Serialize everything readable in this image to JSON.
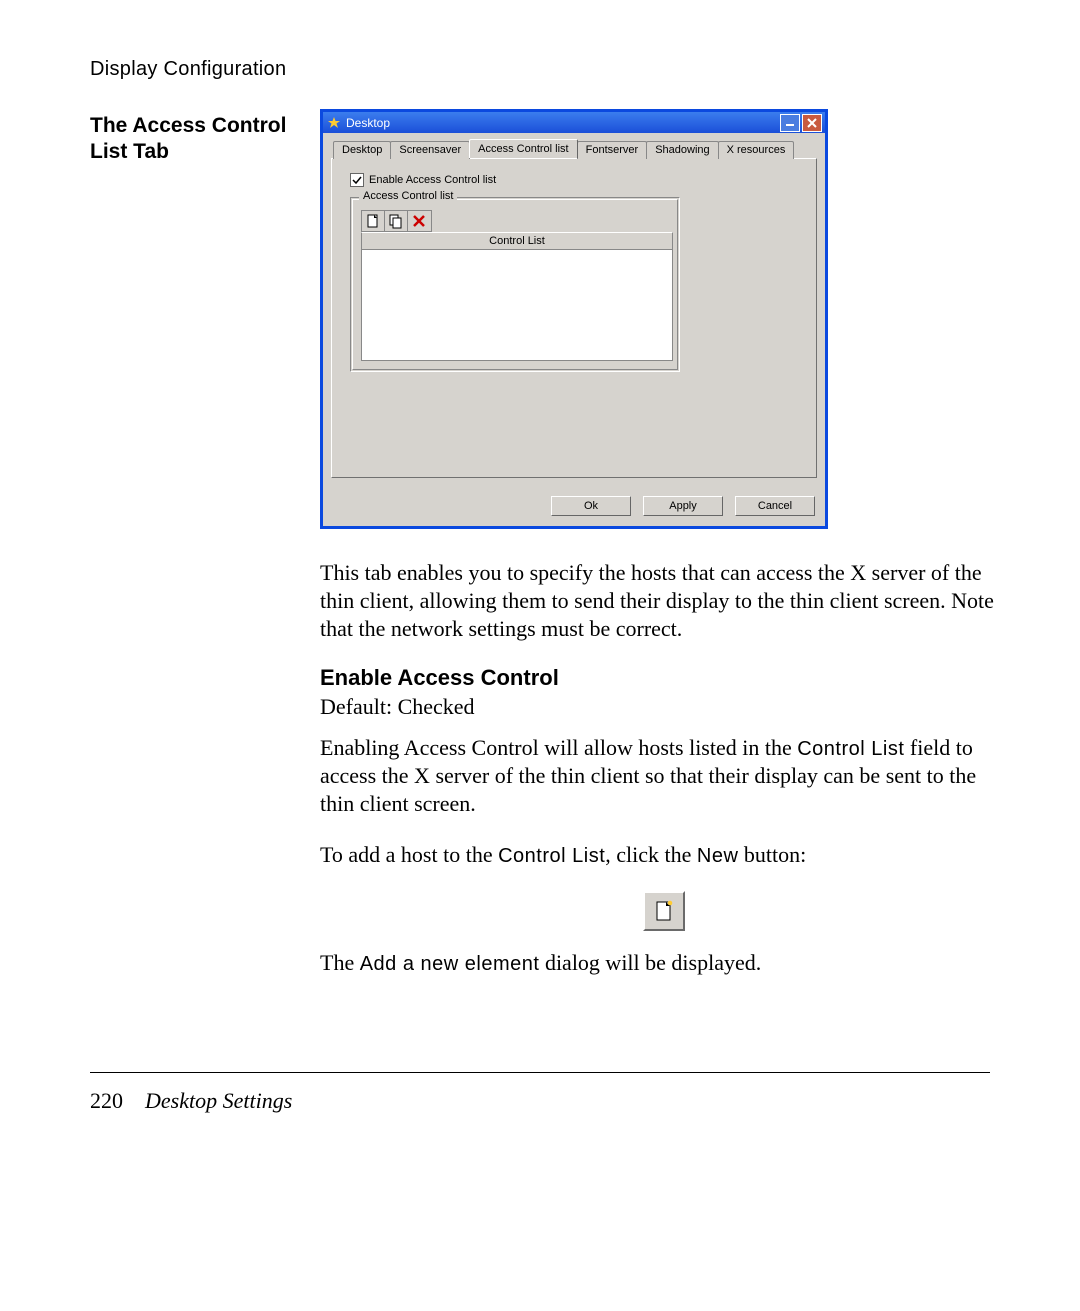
{
  "running_head": "Display Configuration",
  "side_heading_l1": "The Access Control",
  "side_heading_l2": "List Tab",
  "dialog": {
    "title": "Desktop",
    "tabs": [
      "Desktop",
      "Screensaver",
      "Access Control list",
      "Fontserver",
      "Shadowing",
      "X resources"
    ],
    "active_tab_index": 2,
    "checkbox_label": "Enable Access Control list",
    "checkbox_checked": true,
    "group_legend": "Access Control list",
    "list_header": "Control List",
    "buttons": {
      "ok": "Ok",
      "apply": "Apply",
      "cancel": "Cancel"
    },
    "toolbar_icons": [
      "new-icon",
      "copy-icon",
      "delete-icon"
    ]
  },
  "para1": "This tab enables you to specify the hosts that can access the X server of the thin client, allowing them to send their display to the thin client screen. Note that the network settings must be correct.",
  "h_enable": "Enable Access Control",
  "default_line": "Default: Checked",
  "para2a": "Enabling Access Control will allow hosts listed in the ",
  "para2_mono": "Control List",
  "para2b": " field to access the X server of the thin client so that their display can be sent to the thin client screen.",
  "para3a": "To add a host to the ",
  "para3_m1": "Control List",
  "para3b": ", click the ",
  "para3_m2": "New",
  "para3c": " button:",
  "para4a": "The ",
  "para4_m": "Add a new element",
  "para4b": " dialog will be displayed.",
  "footer": {
    "page": "220",
    "section": "Desktop Settings"
  }
}
